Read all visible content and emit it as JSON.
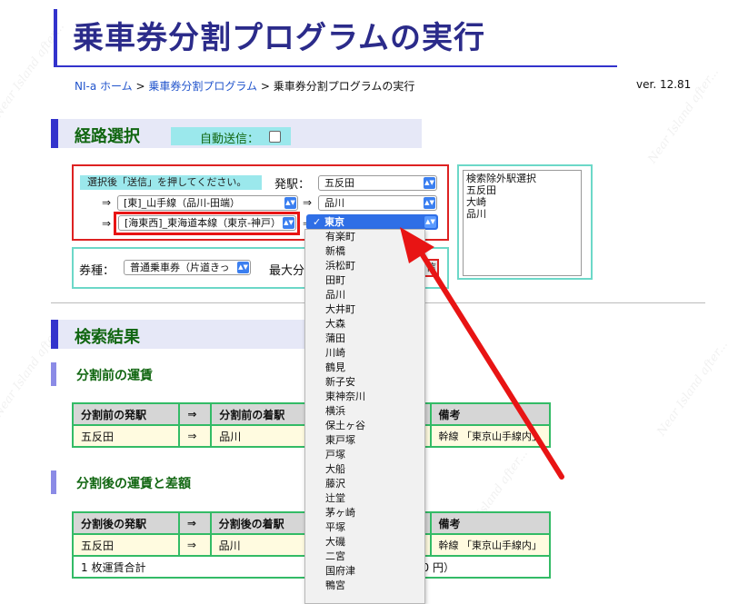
{
  "page": {
    "title": "乗車券分割プログラムの実行",
    "version": "ver. 12.81",
    "breadcrumb": {
      "home": "NI-a ホーム",
      "sep1": " > ",
      "program": "乗車券分割プログラム",
      "sep2": " > ",
      "current": "乗車券分割プログラムの実行"
    }
  },
  "route": {
    "heading": "経路選択",
    "autosend_label": "自動送信：",
    "hint": "選択後「送信」を押してください。",
    "departure_label": "発駅：",
    "departure_value": "五反田",
    "arrow": "⇒",
    "line1_value": "[東]_山手線（品川-田端）",
    "station1_value": "品川",
    "line2_value": "[海東西]_東海道本線（東京-神戸）",
    "station2_value": "東京"
  },
  "exclude": {
    "items": [
      "検索除外駅選択",
      "五反田",
      "大崎",
      "品川"
    ]
  },
  "ticket": {
    "label": "券種：",
    "value": "普通乗車券（片道きっ",
    "max_label": "最大分",
    "button_fragment": "信"
  },
  "results": {
    "heading": "検索結果",
    "before_title": "分割前の運賃",
    "after_title": "分割後の運賃と差額",
    "before_headers": [
      "分割前の発駅",
      "⇒",
      "分割前の着駅",
      "",
      "備考"
    ],
    "before_row": [
      "五反田",
      "⇒",
      "品川",
      "",
      "幹線 「東京山手線内」"
    ],
    "after_headers": [
      "分割後の発駅",
      "⇒",
      "分割後の着駅",
      "",
      "備考"
    ],
    "after_row": [
      "五反田",
      "⇒",
      "品川",
      "",
      "幹線 「東京山手線内」"
    ],
    "total_label": "1 枚運賃合計",
    "total_fragment": "0 円）"
  },
  "dropdown": {
    "selected": "東京",
    "options": [
      "有楽町",
      "新橋",
      "浜松町",
      "田町",
      "品川",
      "大井町",
      "大森",
      "蒲田",
      "川崎",
      "鶴見",
      "新子安",
      "東神奈川",
      "横浜",
      "保土ヶ谷",
      "東戸塚",
      "戸塚",
      "大船",
      "藤沢",
      "辻堂",
      "茅ヶ崎",
      "平塚",
      "大磯",
      "二宮",
      "国府津",
      "鴨宮"
    ]
  },
  "watermark": "Near Island after...",
  "colors": {
    "accent_blue": "#3333cc",
    "heading_green": "#116611",
    "highlight_red": "#e81414",
    "table_border": "#33bb66"
  }
}
